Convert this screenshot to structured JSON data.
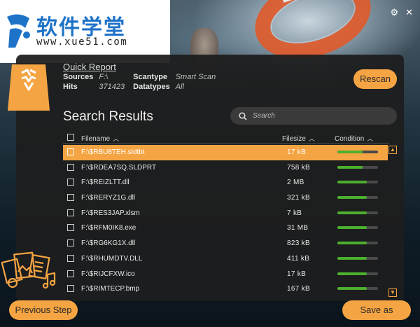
{
  "logo": {
    "title": "软件学堂",
    "url": "www.xue51.com"
  },
  "window": {
    "settings_icon": "gear-icon",
    "close_icon": "close-icon",
    "close_label": "✕"
  },
  "report": {
    "quick_report_label": "Quick Report",
    "sources_label": "Sources",
    "sources_value": "F:\\",
    "scantype_label": "Scantype",
    "scantype_value": "Smart Scan",
    "hits_label": "Hits",
    "hits_value": "371423",
    "datatypes_label": "Datatypes",
    "datatypes_value": "All"
  },
  "buttons": {
    "rescan": "Rescan",
    "previous_step": "Previous Step",
    "save_as": "Save as"
  },
  "search": {
    "title": "Search Results",
    "placeholder": "Search"
  },
  "columns": {
    "filename": "Filename",
    "filesize": "Filesize",
    "condition": "Condition"
  },
  "files": [
    {
      "name": "F:\\$RBU8TEH.sldtbt",
      "size": "17  kB",
      "condition": 0.62,
      "selected": true
    },
    {
      "name": "F:\\$RDEA7SQ.SLDPRT",
      "size": "758  kB",
      "condition": 0.62,
      "selected": false
    },
    {
      "name": "F:\\$REIZLTT.dll",
      "size": "2  MB",
      "condition": 0.72,
      "selected": false
    },
    {
      "name": "F:\\$RERYZ1G.dll",
      "size": "321  kB",
      "condition": 0.72,
      "selected": false
    },
    {
      "name": "F:\\$RES3JAP.xlsm",
      "size": "7  kB",
      "condition": 0.72,
      "selected": false
    },
    {
      "name": "F:\\$RFM0IK8.exe",
      "size": "31  MB",
      "condition": 0.72,
      "selected": false
    },
    {
      "name": "F:\\$RG6KG1X.dll",
      "size": "823  kB",
      "condition": 0.72,
      "selected": false
    },
    {
      "name": "F:\\$RHUMDTV.DLL",
      "size": "411  kB",
      "condition": 0.72,
      "selected": false
    },
    {
      "name": "F:\\$RIJCFXW.ico",
      "size": "17  kB",
      "condition": 0.72,
      "selected": false
    },
    {
      "name": "F:\\$RIMTECP.bmp",
      "size": "167  kB",
      "condition": 0.72,
      "selected": false
    }
  ],
  "colors": {
    "accent": "#f5a443",
    "panel": "#1e1e1e",
    "condition_good": "#4caf2e"
  }
}
